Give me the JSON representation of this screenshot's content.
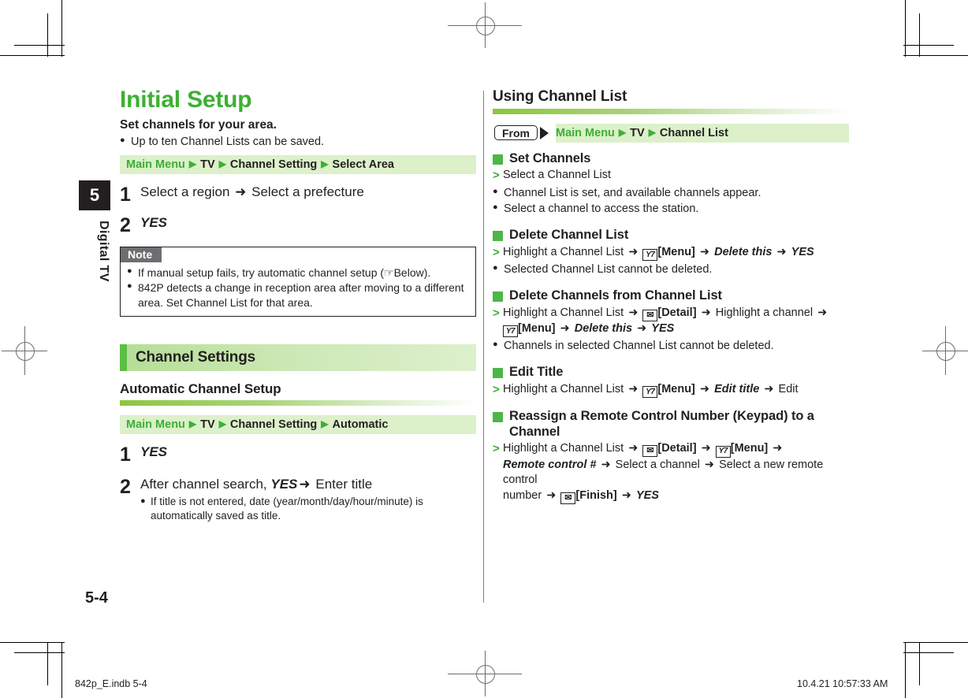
{
  "chapter": {
    "number": "5",
    "label": "Digital TV"
  },
  "footer": {
    "page_number": "5-4",
    "file_label": "842p_E.indb   5-4",
    "timestamp": "10.4.21   10:57:33 AM"
  },
  "left_column": {
    "title": "Initial Setup",
    "lead": "Set channels for your area.",
    "lead_bullet": "Up to ten Channel Lists can be saved.",
    "path": {
      "start": "Main Menu",
      "items": [
        "TV",
        "Channel Setting",
        "Select Area"
      ]
    },
    "steps": [
      {
        "num": "1",
        "text_a": "Select a region",
        "arrow": "➜",
        "text_b": "Select a prefecture"
      },
      {
        "num": "2",
        "italic": "YES"
      }
    ],
    "note": {
      "tag": "Note",
      "items": [
        "If manual setup fails, try automatic channel setup (☞Below).",
        "842P detects a change in reception area after moving to a different area. Set Channel List for that area."
      ]
    },
    "section_bar": "Channel Settings",
    "subsection": "Automatic Channel Setup",
    "path2": {
      "start": "Main Menu",
      "items": [
        "TV",
        "Channel Setting",
        "Automatic"
      ]
    },
    "steps2": [
      {
        "num": "1",
        "italic": "YES"
      },
      {
        "num": "2",
        "pre": "After channel search, ",
        "italic": "YES",
        "arrow": "➜",
        "post": "Enter title",
        "sub": "If title is not entered, date (year/month/day/hour/minute) is automatically saved as title."
      }
    ]
  },
  "right_column": {
    "title": "Using Channel List",
    "from_label": "From",
    "path": {
      "start": "Main Menu",
      "items": [
        "TV",
        "Channel List"
      ]
    },
    "blocks": [
      {
        "title": "Set Channels",
        "steps": [
          "Select a Channel List"
        ],
        "bullets": [
          "Channel List is set, and available channels appear.",
          "Select a channel to access the station."
        ]
      },
      {
        "title": "Delete Channel List",
        "steps_rich": "Highlight a Channel List ➜ [Y!][Menu] ➜ Delete this ➜ YES",
        "bullets": [
          "Selected Channel List cannot be deleted."
        ]
      },
      {
        "title": "Delete Channels from Channel List",
        "steps_rich": "Highlight a Channel List ➜ [✉][Detail] ➜ Highlight a channel ➜ [Y!][Menu] ➜ Delete this ➜ YES",
        "bullets": [
          "Channels in selected Channel List cannot be deleted."
        ]
      },
      {
        "title": "Edit Title",
        "steps_rich": "Highlight a Channel List ➜ [Y!][Menu] ➜ Edit title ➜ Edit",
        "bullets": []
      },
      {
        "title": "Reassign a Remote Control Number (Keypad) to a Channel",
        "steps_rich": "Highlight a Channel List ➜ [✉][Detail] ➜ [Y!][Menu] ➜ Remote control # ➜ Select a channel ➜ Select a new remote control number ➜ [✉][Finish] ➜ YES",
        "bullets": []
      }
    ],
    "labels": {
      "menu": "[Menu]",
      "detail": "[Detail]",
      "finish": "[Finish]",
      "delete_this": "Delete this",
      "edit_title_italic": "Edit title",
      "edit": "Edit",
      "yes": "YES",
      "remote_control_hash": "Remote control #",
      "highlight_channel_list": "Highlight a Channel List",
      "highlight_channel": "Highlight a channel",
      "select_channel": "Select a channel",
      "select_new_number": "Select a new remote control",
      "number_word": "number",
      "select_a_channel_list": "Select a Channel List"
    }
  },
  "colors": {
    "green_title": "#3cb034",
    "green_square": "#4cb648",
    "path_bg": "#dcf0ca",
    "bar_accent": "#5cbf45",
    "note_tag_bg": "#6d6e71",
    "text": "#231f20"
  }
}
